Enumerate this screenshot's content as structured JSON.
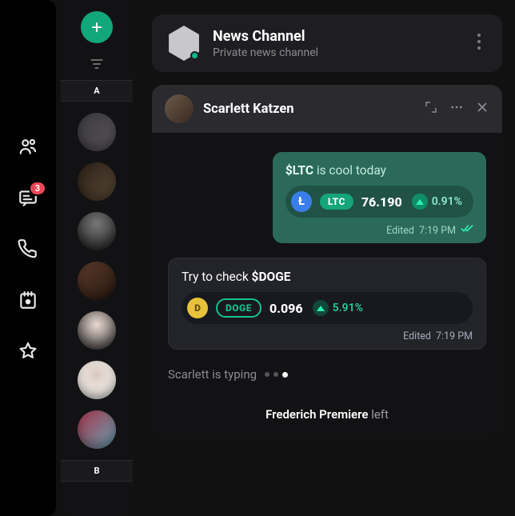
{
  "nav": {
    "messages_badge": "3"
  },
  "contacts": {
    "section_a": "A",
    "section_b": "B"
  },
  "header": {
    "title": "News Channel",
    "subtitle": "Private news channel"
  },
  "chat": {
    "title": "Scarlett Katzen",
    "messages": [
      {
        "prefix_strong": "$LTC",
        "prefix_rest": " is cool today",
        "coin_letter": "Ł",
        "symbol": "LTC",
        "price": "76.190",
        "change": "0.91%",
        "edited_label": "Edited",
        "time": "7:19 PM"
      },
      {
        "prefix_plain": "Try to check ",
        "suffix_strong": "$DOGE",
        "coin_letter": "D",
        "symbol": "DOGE",
        "price": "0.096",
        "change": "5.91%",
        "edited_label": "Edited",
        "time": "7:19 PM"
      }
    ],
    "typing": "Scarlett is typing",
    "footer_name": "Frederich Premiere",
    "footer_action": "left"
  }
}
